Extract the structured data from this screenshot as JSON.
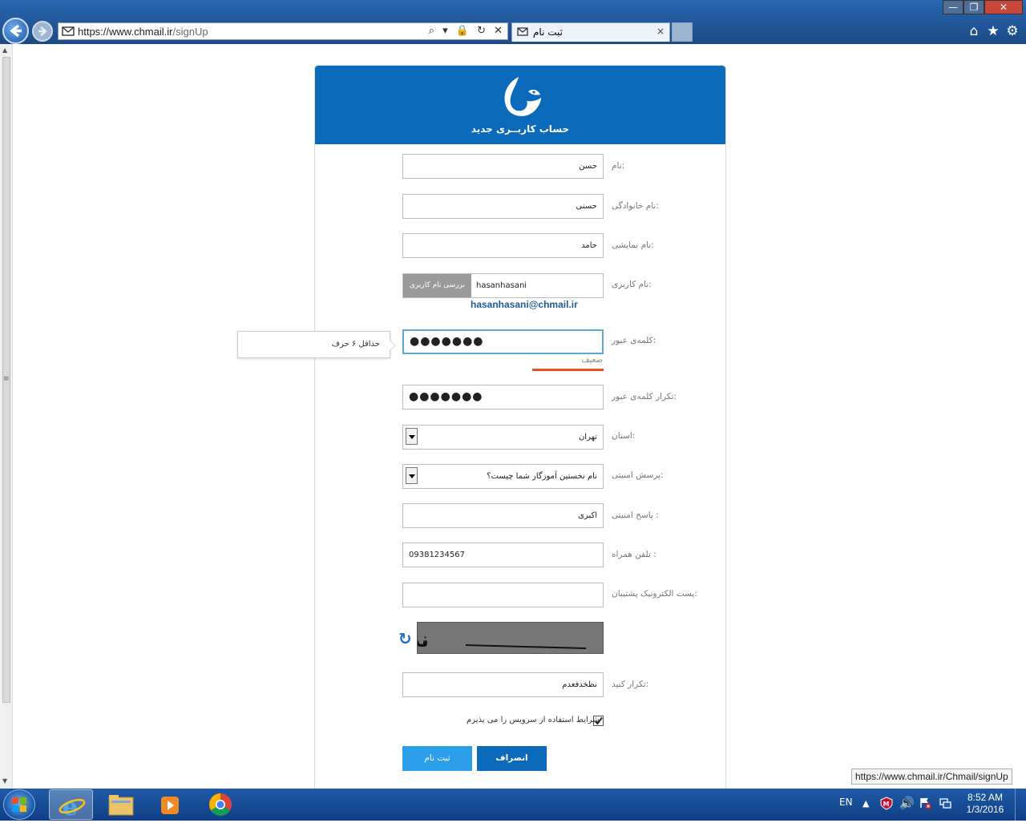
{
  "browser": {
    "url_prefix": "https://www.",
    "url_domain": "chmail.ir",
    "url_path": "/signUp",
    "address_controls": "⌕ ▾ 🔒 ↻ ✕",
    "tab_title": "ثبت نام",
    "tab_close": "×",
    "window_min": "—",
    "window_max": "❐",
    "window_close": "✕",
    "icons": [
      "back-icon",
      "forward-icon",
      "mail-icon",
      "home-icon",
      "star-icon",
      "gear-icon"
    ]
  },
  "form": {
    "header_title": "حساب کاربــری جدید",
    "fields": {
      "first_name": {
        "label": "نام:",
        "value": "حسن"
      },
      "last_name": {
        "label": "نام خانوادگی:",
        "value": "حسنی"
      },
      "display_name": {
        "label": "نام نمایشی:",
        "value": "حامد"
      },
      "username": {
        "label": "نام کاربری:",
        "value": "hasanhasani",
        "check_button": "بررسی نام کاربری",
        "email_note": "hasanhasani@chmail.ir"
      },
      "password": {
        "label": "کلمه‌ی عبور:",
        "value": "●●●●●●●",
        "hint": "حداقل ۶ حرف",
        "strength": "ضعیف"
      },
      "password_repeat": {
        "label": "تکرار کلمه‌ی عبور:",
        "value": "●●●●●●●"
      },
      "province": {
        "label": "استان:",
        "value": "تهران"
      },
      "security_question": {
        "label": "پرسش امنیتی:",
        "value": "نام نخستین آموزگار شما چیست؟"
      },
      "security_answer": {
        "label": "پاسخ امنیتی :",
        "value": "اکبری"
      },
      "mobile": {
        "label": "تلفن همراه :",
        "value": "09381234567"
      },
      "backup_email": {
        "label": "پست الکترونیک پشتیبان:",
        "value": ""
      },
      "captcha_repeat": {
        "label": "تکرار کنید:",
        "value": "نظخدفعدم"
      }
    },
    "captcha_text": "نظاخدفعدم",
    "terms": "شرایط استفاده از سرویس را می پذیرم",
    "terms_checked": true,
    "submit_label": "ثبت نام",
    "cancel_label": "انصراف"
  },
  "status_bar": {
    "url": "https://www.chmail.ir/Chmail/signUp"
  },
  "taskbar": {
    "lang": "EN",
    "time": "8:52 AM",
    "date": "1/3/2016",
    "apps": [
      "internet-explorer",
      "file-explorer",
      "media-player",
      "chrome"
    ]
  },
  "colors": {
    "header": "#0b6ab9",
    "submit": "#2d9ee9",
    "cancel": "#0b6ab9",
    "strength_weak": "#e8501d",
    "email_note": "#1a5d9a"
  }
}
